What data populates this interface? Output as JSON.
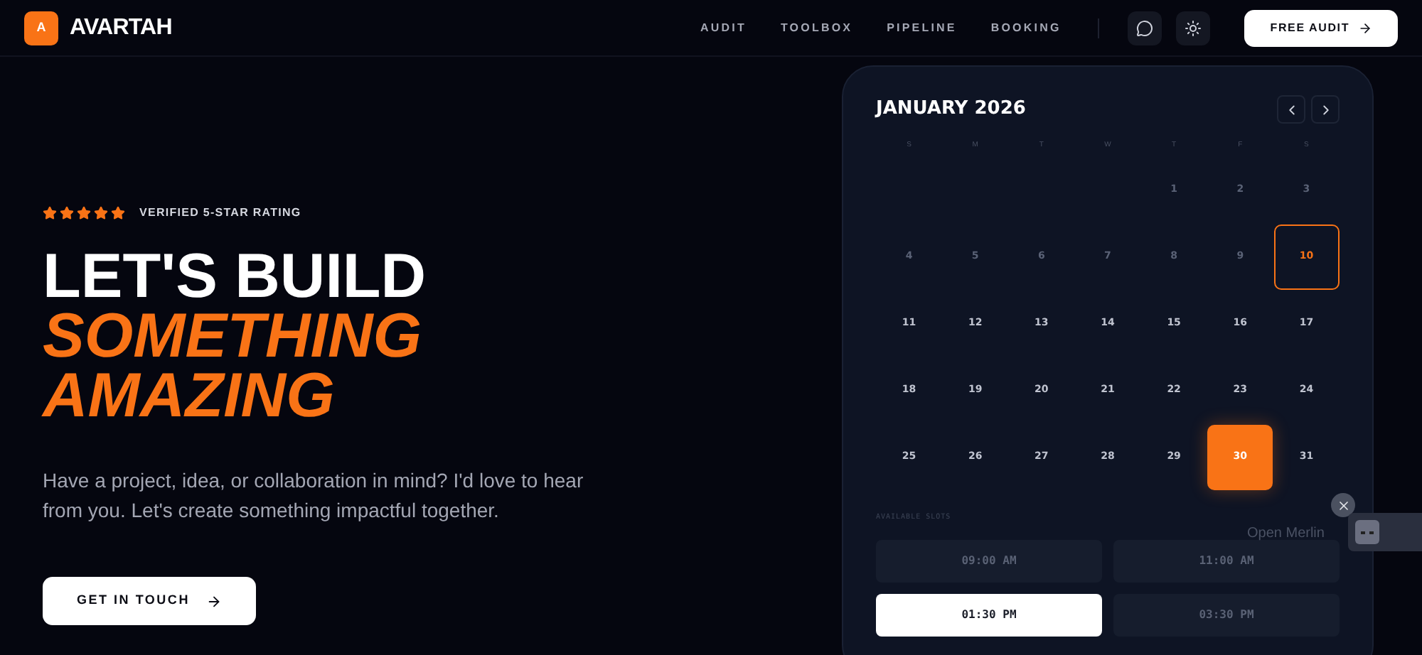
{
  "brand": {
    "logo": "A",
    "name": "AVARTAH"
  },
  "nav": {
    "links": [
      "AUDIT",
      "TOOLBOX",
      "PIPELINE",
      "BOOKING"
    ],
    "cta": "FREE AUDIT"
  },
  "hero": {
    "stars": 5,
    "rating_label": "VERIFIED 5-STAR RATING",
    "title_line": "LET'S BUILD",
    "accent_lines": [
      "SOMETHING",
      "AMAZING"
    ],
    "subtitle": "Have a project, idea, or collaboration in mind? I'd love to hear from you. Let's create something impactful together.",
    "button": "GET IN TOUCH"
  },
  "calendar": {
    "month": "JANUARY 2026",
    "weekdays": [
      "S",
      "M",
      "T",
      "W",
      "T",
      "F",
      "S"
    ],
    "days": [
      {
        "kind": "blank"
      },
      {
        "kind": "blank"
      },
      {
        "kind": "blank"
      },
      {
        "kind": "blank"
      },
      {
        "kind": "day",
        "label": "1",
        "disabled": true,
        "today": false,
        "selected": false
      },
      {
        "kind": "day",
        "label": "2",
        "disabled": true,
        "today": false,
        "selected": false
      },
      {
        "kind": "day",
        "label": "3",
        "disabled": true,
        "today": false,
        "selected": false
      },
      {
        "kind": "day",
        "label": "4",
        "disabled": true,
        "today": false,
        "selected": false
      },
      {
        "kind": "day",
        "label": "5",
        "disabled": true,
        "today": false,
        "selected": false
      },
      {
        "kind": "day",
        "label": "6",
        "disabled": true,
        "today": false,
        "selected": false
      },
      {
        "kind": "day",
        "label": "7",
        "disabled": true,
        "today": false,
        "selected": false
      },
      {
        "kind": "day",
        "label": "8",
        "disabled": true,
        "today": false,
        "selected": false
      },
      {
        "kind": "day",
        "label": "9",
        "disabled": true,
        "today": false,
        "selected": false
      },
      {
        "kind": "day",
        "label": "10",
        "disabled": false,
        "today": true,
        "selected": false
      },
      {
        "kind": "day",
        "label": "11",
        "disabled": false,
        "today": false,
        "selected": false
      },
      {
        "kind": "day",
        "label": "12",
        "disabled": false,
        "today": false,
        "selected": false
      },
      {
        "kind": "day",
        "label": "13",
        "disabled": false,
        "today": false,
        "selected": false
      },
      {
        "kind": "day",
        "label": "14",
        "disabled": false,
        "today": false,
        "selected": false
      },
      {
        "kind": "day",
        "label": "15",
        "disabled": false,
        "today": false,
        "selected": false
      },
      {
        "kind": "day",
        "label": "16",
        "disabled": false,
        "today": false,
        "selected": false
      },
      {
        "kind": "day",
        "label": "17",
        "disabled": false,
        "today": false,
        "selected": false
      },
      {
        "kind": "day",
        "label": "18",
        "disabled": false,
        "today": false,
        "selected": false
      },
      {
        "kind": "day",
        "label": "19",
        "disabled": false,
        "today": false,
        "selected": false
      },
      {
        "kind": "day",
        "label": "20",
        "disabled": false,
        "today": false,
        "selected": false
      },
      {
        "kind": "day",
        "label": "21",
        "disabled": false,
        "today": false,
        "selected": false
      },
      {
        "kind": "day",
        "label": "22",
        "disabled": false,
        "today": false,
        "selected": false
      },
      {
        "kind": "day",
        "label": "23",
        "disabled": false,
        "today": false,
        "selected": false
      },
      {
        "kind": "day",
        "label": "24",
        "disabled": false,
        "today": false,
        "selected": false
      },
      {
        "kind": "day",
        "label": "25",
        "disabled": false,
        "today": false,
        "selected": false
      },
      {
        "kind": "day",
        "label": "26",
        "disabled": false,
        "today": false,
        "selected": false
      },
      {
        "kind": "day",
        "label": "27",
        "disabled": false,
        "today": false,
        "selected": false
      },
      {
        "kind": "day",
        "label": "28",
        "disabled": false,
        "today": false,
        "selected": false
      },
      {
        "kind": "day",
        "label": "29",
        "disabled": false,
        "today": false,
        "selected": false
      },
      {
        "kind": "day",
        "label": "30",
        "disabled": false,
        "today": false,
        "selected": true
      },
      {
        "kind": "day",
        "label": "31",
        "disabled": false,
        "today": false,
        "selected": false
      }
    ],
    "slots_label": "AVAILABLE SLOTS",
    "slots": [
      {
        "time": "09:00 AM",
        "selected": false
      },
      {
        "time": "11:00 AM",
        "selected": false
      },
      {
        "time": "01:30 PM",
        "selected": true
      },
      {
        "time": "03:30 PM",
        "selected": false
      }
    ]
  },
  "assistant": {
    "label": "Open Merlin"
  }
}
